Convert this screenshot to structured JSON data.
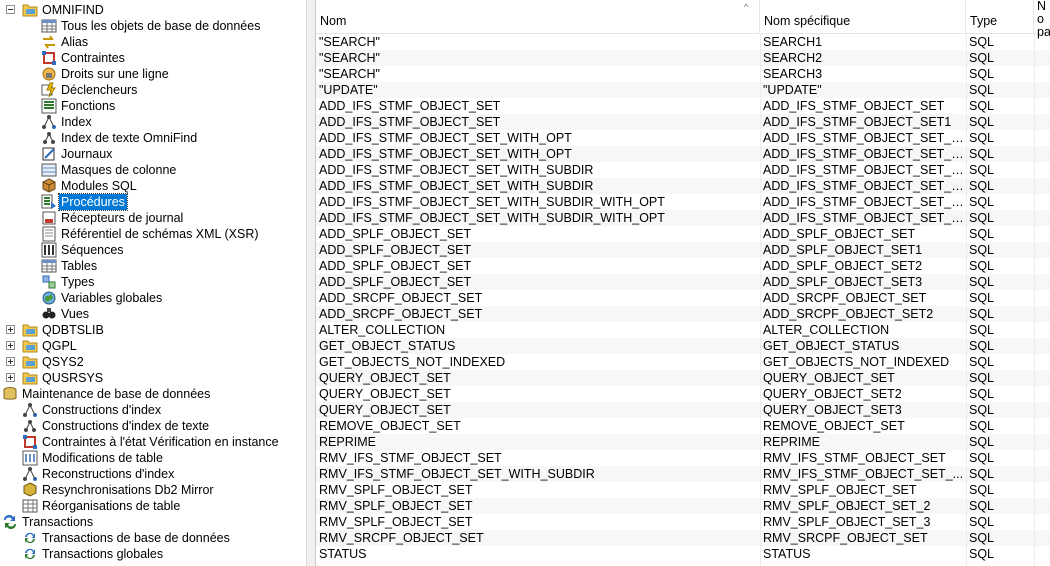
{
  "tree": {
    "omnifind_label": "OMNIFIND",
    "children": [
      "Tous les objets de base de données",
      "Alias",
      "Contraintes",
      "Droits sur une ligne",
      "Déclencheurs",
      "Fonctions",
      "Index",
      "Index de texte OmniFind",
      "Journaux",
      "Masques de colonne",
      "Modules SQL",
      "Procédures",
      "Récepteurs de journal",
      "Référentiel de schémas XML (XSR)",
      "Séquences",
      "Tables",
      "Types",
      "Variables globales",
      "Vues"
    ],
    "selected_index": 11,
    "libraries": [
      "QDBTSLIB",
      "QGPL",
      "QSYS2",
      "QUSRSYS"
    ],
    "maintenance_label": "Maintenance de base de données",
    "maintenance_items": [
      "Constructions d'index",
      "Constructions d'index de texte",
      "Contraintes à l'état Vérification en instance",
      "Modifications de table",
      "Reconstructions d'index",
      "Resynchronisations Db2 Mirror",
      "Réorganisations de table"
    ],
    "transactions_label": "Transactions",
    "transactions_items": [
      "Transactions de base de données",
      "Transactions globales"
    ]
  },
  "list": {
    "columns": [
      "Nom",
      "Nom spécifique",
      "Type",
      "No pa"
    ],
    "rows": [
      [
        "\"SEARCH\"",
        "SEARCH1",
        "SQL"
      ],
      [
        "\"SEARCH\"",
        "SEARCH2",
        "SQL"
      ],
      [
        "\"SEARCH\"",
        "SEARCH3",
        "SQL"
      ],
      [
        "\"UPDATE\"",
        "\"UPDATE\"",
        "SQL"
      ],
      [
        "ADD_IFS_STMF_OBJECT_SET",
        "ADD_IFS_STMF_OBJECT_SET",
        "SQL"
      ],
      [
        "ADD_IFS_STMF_OBJECT_SET",
        "ADD_IFS_STMF_OBJECT_SET1",
        "SQL"
      ],
      [
        "ADD_IFS_STMF_OBJECT_SET_WITH_OPT",
        "ADD_IFS_STMF_OBJECT_SET_W...",
        "SQL"
      ],
      [
        "ADD_IFS_STMF_OBJECT_SET_WITH_OPT",
        "ADD_IFS_STMF_OBJECT_SET_W...",
        "SQL"
      ],
      [
        "ADD_IFS_STMF_OBJECT_SET_WITH_SUBDIR",
        "ADD_IFS_STMF_OBJECT_SET_W...",
        "SQL"
      ],
      [
        "ADD_IFS_STMF_OBJECT_SET_WITH_SUBDIR",
        "ADD_IFS_STMF_OBJECT_SET_W...",
        "SQL"
      ],
      [
        "ADD_IFS_STMF_OBJECT_SET_WITH_SUBDIR_WITH_OPT",
        "ADD_IFS_STMF_OBJECT_SET_W...",
        "SQL"
      ],
      [
        "ADD_IFS_STMF_OBJECT_SET_WITH_SUBDIR_WITH_OPT",
        "ADD_IFS_STMF_OBJECT_SET_W...",
        "SQL"
      ],
      [
        "ADD_SPLF_OBJECT_SET",
        "ADD_SPLF_OBJECT_SET",
        "SQL"
      ],
      [
        "ADD_SPLF_OBJECT_SET",
        "ADD_SPLF_OBJECT_SET1",
        "SQL"
      ],
      [
        "ADD_SPLF_OBJECT_SET",
        "ADD_SPLF_OBJECT_SET2",
        "SQL"
      ],
      [
        "ADD_SPLF_OBJECT_SET",
        "ADD_SPLF_OBJECT_SET3",
        "SQL"
      ],
      [
        "ADD_SRCPF_OBJECT_SET",
        "ADD_SRCPF_OBJECT_SET",
        "SQL"
      ],
      [
        "ADD_SRCPF_OBJECT_SET",
        "ADD_SRCPF_OBJECT_SET2",
        "SQL"
      ],
      [
        "ALTER_COLLECTION",
        "ALTER_COLLECTION",
        "SQL"
      ],
      [
        "GET_OBJECT_STATUS",
        "GET_OBJECT_STATUS",
        "SQL"
      ],
      [
        "GET_OBJECTS_NOT_INDEXED",
        "GET_OBJECTS_NOT_INDEXED",
        "SQL"
      ],
      [
        "QUERY_OBJECT_SET",
        "QUERY_OBJECT_SET",
        "SQL"
      ],
      [
        "QUERY_OBJECT_SET",
        "QUERY_OBJECT_SET2",
        "SQL"
      ],
      [
        "QUERY_OBJECT_SET",
        "QUERY_OBJECT_SET3",
        "SQL"
      ],
      [
        "REMOVE_OBJECT_SET",
        "REMOVE_OBJECT_SET",
        "SQL"
      ],
      [
        "REPRIME",
        "REPRIME",
        "SQL"
      ],
      [
        "RMV_IFS_STMF_OBJECT_SET",
        "RMV_IFS_STMF_OBJECT_SET",
        "SQL"
      ],
      [
        "RMV_IFS_STMF_OBJECT_SET_WITH_SUBDIR",
        "RMV_IFS_STMF_OBJECT_SET_...",
        "SQL"
      ],
      [
        "RMV_SPLF_OBJECT_SET",
        "RMV_SPLF_OBJECT_SET",
        "SQL"
      ],
      [
        "RMV_SPLF_OBJECT_SET",
        "RMV_SPLF_OBJECT_SET_2",
        "SQL"
      ],
      [
        "RMV_SPLF_OBJECT_SET",
        "RMV_SPLF_OBJECT_SET_3",
        "SQL"
      ],
      [
        "RMV_SRCPF_OBJECT_SET",
        "RMV_SRCPF_OBJECT_SET",
        "SQL"
      ],
      [
        "STATUS",
        "STATUS",
        "SQL"
      ]
    ]
  },
  "colors": {
    "selection": "#0078d7",
    "folder": "#f3c64c"
  }
}
